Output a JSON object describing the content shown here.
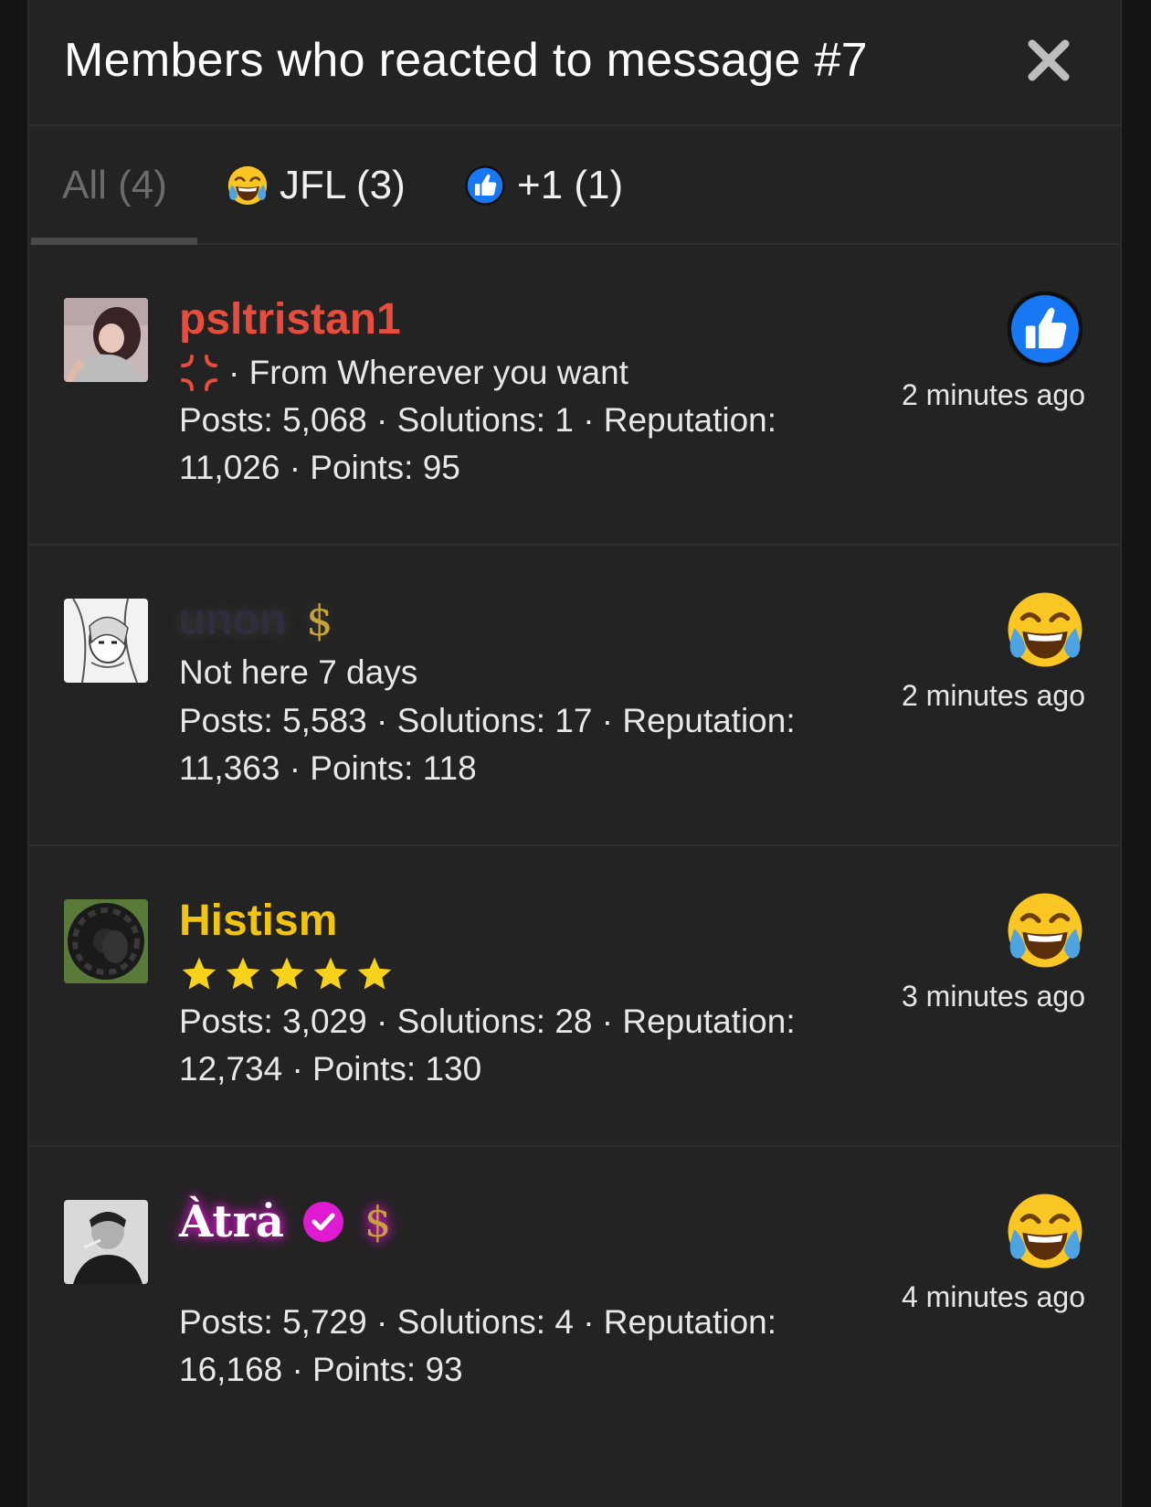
{
  "dialog": {
    "title": "Members who reacted to message #7",
    "close_label": "close"
  },
  "tabs": [
    {
      "label": "All (4)",
      "icon": "none",
      "active": true
    },
    {
      "label": "JFL (3)",
      "icon": "crying-laughing-emoji-icon",
      "active": false
    },
    {
      "label": "+1 (1)",
      "icon": "thumbs-up-icon",
      "active": false
    }
  ],
  "members": [
    {
      "username": "psltristan1",
      "username_color": "#e74c3c",
      "line2": "· From Wherever you want",
      "line2_icon": "anger-symbol-icon",
      "stats": "Posts: 5,068 · Solutions: 1 · Reputation: 11,026 · Points: 95",
      "reaction": "thumbs-up-icon",
      "time": "2 minutes ago"
    },
    {
      "username": "unon",
      "username_color": "#2e2e3e",
      "line2": "Not here 7 days",
      "stats": "Posts: 5,583 · Solutions: 17 · Reputation: 11,363 · Points: 118",
      "reaction": "crying-laughing-emoji-icon",
      "time": "2 minutes ago",
      "badge_symbol": "$"
    },
    {
      "username": "Histism",
      "username_color": "#f1c40f",
      "rating_stars": 5,
      "stats": "Posts: 3,029 · Solutions: 28 · Reputation: 12,734 · Points: 130",
      "reaction": "crying-laughing-emoji-icon",
      "time": "3 minutes ago"
    },
    {
      "username": "Àtrȧ",
      "username_color": "#ffffff",
      "verified": true,
      "stats": "Posts: 5,729 · Solutions: 4 · Reputation: 16,168 · Points: 93",
      "reaction": "crying-laughing-emoji-icon",
      "time": "4 minutes ago",
      "badge_symbol": "$"
    }
  ]
}
